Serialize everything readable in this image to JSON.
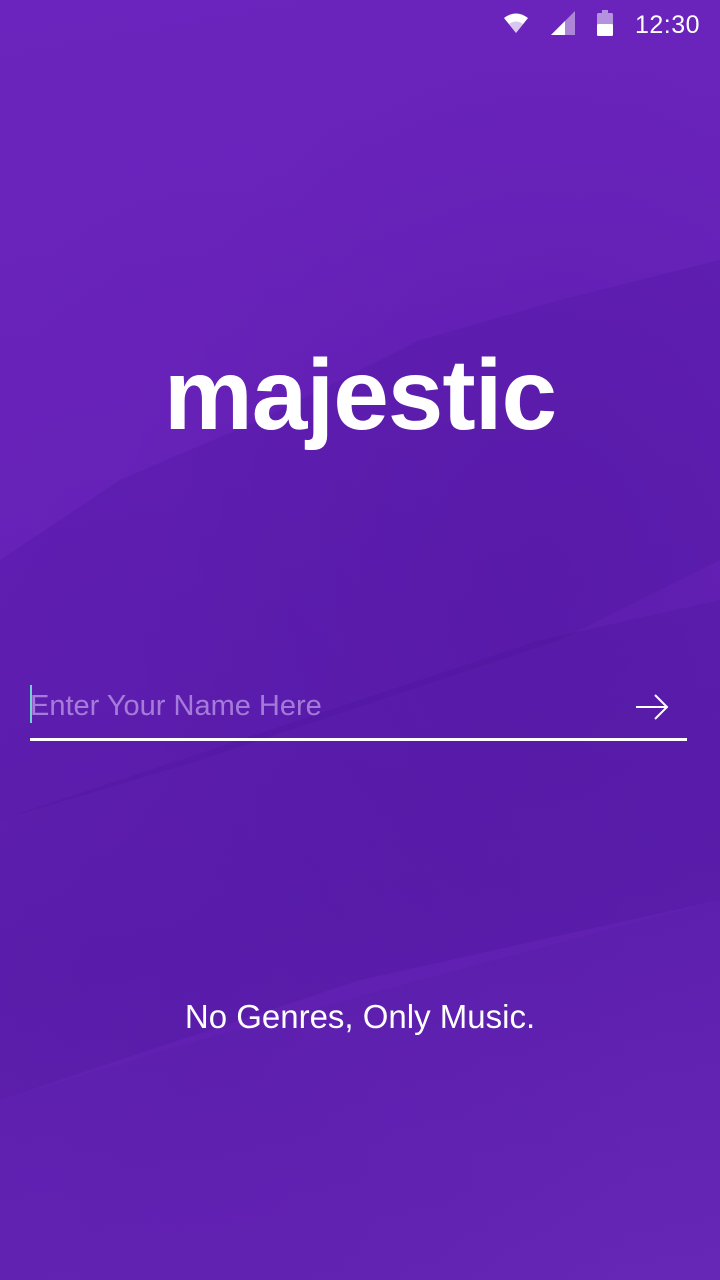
{
  "status_bar": {
    "time": "12:30",
    "icons": [
      "wifi-icon",
      "signal-icon",
      "battery-icon"
    ]
  },
  "app": {
    "logo_text": "majestic",
    "tagline": "No Genres, Only Music."
  },
  "name_form": {
    "placeholder": "Enter Your Name Here",
    "value": "",
    "submit_icon": "arrow-right-icon"
  },
  "colors": {
    "background": "#6923ba",
    "text": "#ffffff",
    "cursor": "#6fd4d0"
  }
}
